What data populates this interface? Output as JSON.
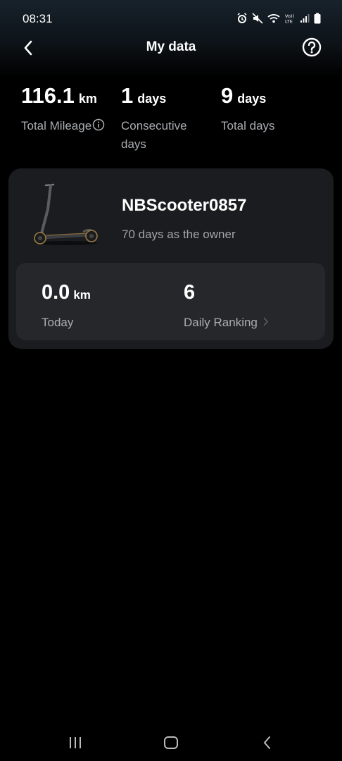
{
  "status_bar": {
    "time": "08:31",
    "icons": [
      "alarm-icon",
      "mute-icon",
      "wifi-icon",
      "volte-icon",
      "signal-icon",
      "battery-icon"
    ]
  },
  "header": {
    "title": "My data",
    "back_icon": "chevron-left-icon",
    "help_icon": "question-circle-icon"
  },
  "stats": {
    "mileage": {
      "value": "116.1",
      "unit": "km",
      "label": "Total Mileage"
    },
    "consecutive": {
      "value": "1",
      "unit": "days",
      "label": "Consecutive days"
    },
    "total": {
      "value": "9",
      "unit": "days",
      "label": "Total days"
    }
  },
  "device": {
    "name": "NBScooter0857",
    "owner_text": "70 days as the owner",
    "today": {
      "value": "0.0",
      "unit": "km",
      "label": "Today"
    },
    "ranking": {
      "value": "6",
      "label": "Daily Ranking"
    }
  },
  "colors": {
    "background": "#000000",
    "card": "#1a1c1f",
    "inner_card": "#25272a",
    "secondary_text": "#a9adb2"
  }
}
